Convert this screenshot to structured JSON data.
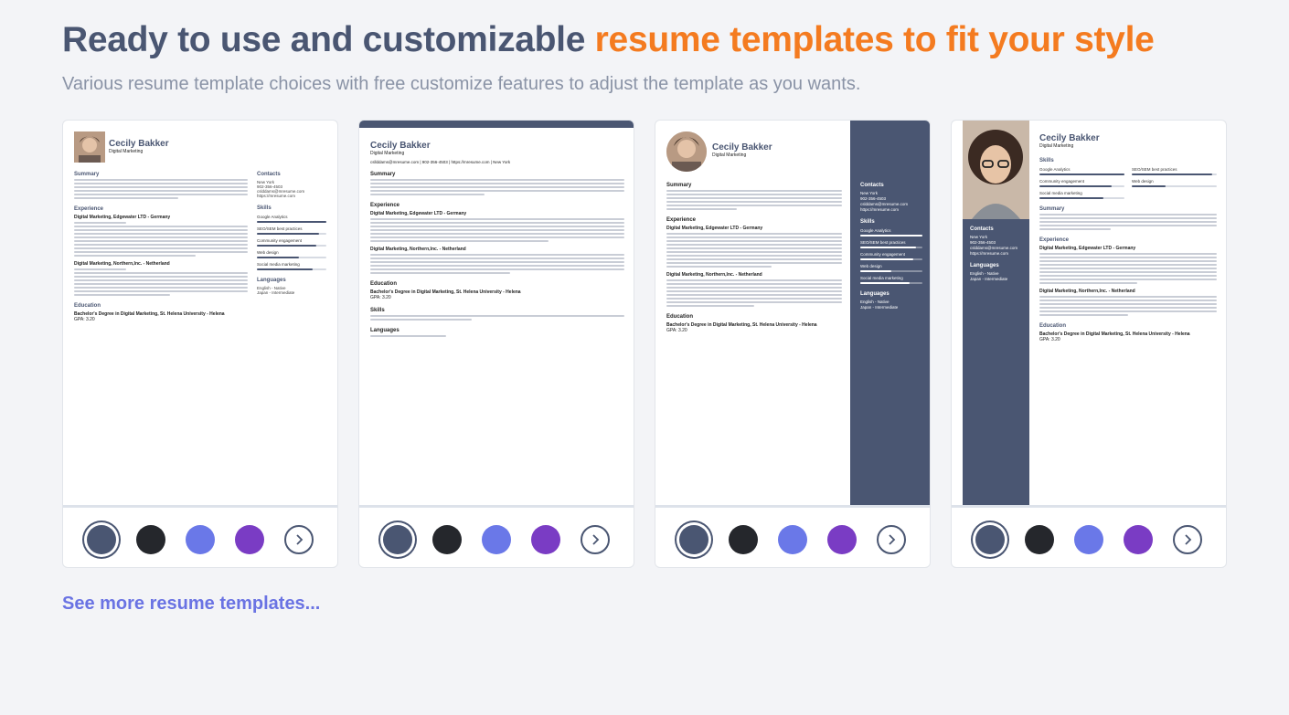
{
  "header": {
    "title_part1": "Ready to use and customizable",
    "title_part2": "resume templates to fit your style",
    "subtitle": "Various resume template choices with free customize features to adjust the template as you wants."
  },
  "resume": {
    "name": "Cecily Bakker",
    "role": "Digital Marketing",
    "sections": {
      "summary": "Summary",
      "experience": "Experience",
      "education": "Education",
      "skills": "Skills",
      "languages": "Languages",
      "contacts": "Contacts"
    },
    "contact": {
      "city": "New York",
      "phone": "902-356-4503",
      "email": "cslddams@mresume.com",
      "web": "https://mresume.com",
      "line": "csllddams@mresume.com | 902-356-4503 | https://mresume.com | New York"
    },
    "skills": [
      "Google Analytics",
      "SEO/SEM best practices",
      "Community engagement",
      "Web design",
      "Social media marketing"
    ],
    "languages": [
      "English - Native",
      "Japan - Intermediate"
    ],
    "job1": "Digital Marketing, Edgewater LTD - Germany",
    "job2": "Digital Marketing, Northern,Inc. - Netherland",
    "edu": "Bachelor's Degree in Digital Marketing, St. Helena University - Helena",
    "gpa": "GPA: 3.20"
  },
  "swatch_colors": [
    "#4a5672",
    "#25272c",
    "#6a78e8",
    "#7a3cc4"
  ],
  "link": {
    "see_more": "See more resume templates..."
  }
}
